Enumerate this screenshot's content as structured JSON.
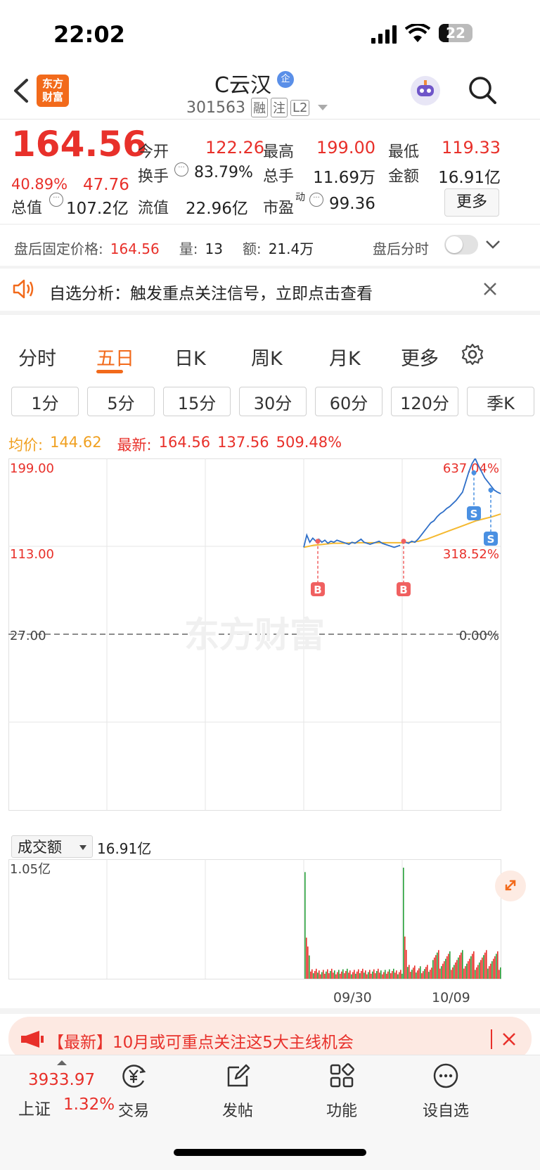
{
  "status_bar": {
    "time": "22:02",
    "battery": "22"
  },
  "header": {
    "logo_line1": "东方",
    "logo_line2": "财富",
    "stock_name": "C云汉",
    "badge": "企",
    "code": "301563",
    "tag1": "融",
    "tag2": "注",
    "tag3": "L2"
  },
  "quote": {
    "price": "164.56",
    "change_pct": "40.89%",
    "change": "47.76",
    "open_label": "今开",
    "open": "122.26",
    "high_label": "最高",
    "high": "199.00",
    "low_label": "最低",
    "low": "119.33",
    "turnover_label": "换手",
    "turnover": "83.79%",
    "volume_label": "总手",
    "volume": "11.69万",
    "amount_label": "金额",
    "amount": "16.91亿",
    "mktcap_label": "总值",
    "mktcap": "107.2亿",
    "float_label": "流值",
    "float_cap": "22.96亿",
    "pe_label": "市盈",
    "pe_sup": "动",
    "pe": "99.36",
    "more_button": "更多"
  },
  "after_hours": {
    "price_label": "盘后固定价格:",
    "price": "164.56",
    "vol_label": "量:",
    "vol": "13",
    "amt_label": "额:",
    "amt": "21.4万",
    "toggle_label": "盘后分时",
    "toggle_on": false
  },
  "notice": {
    "text": "自选分析：触发重点关注信号，立即点击查看"
  },
  "tabs": [
    {
      "label": "分时"
    },
    {
      "label": "五日"
    },
    {
      "label": "日K"
    },
    {
      "label": "周K"
    },
    {
      "label": "月K"
    },
    {
      "label": "更多"
    }
  ],
  "active_tab": "五日",
  "periods": [
    "1分",
    "5分",
    "15分",
    "30分",
    "60分",
    "120分",
    "季K"
  ],
  "chart_header": {
    "avg_label": "均价:",
    "avg": "144.62",
    "latest_label": "最新:",
    "latest": "164.56",
    "change": "137.56",
    "pct": "509.48%"
  },
  "watermark": "东方财富",
  "volume_header": {
    "selector": "成交额",
    "value": "16.91亿"
  },
  "chart_data": {
    "type": "line",
    "y_left_ticks": [
      "199.00",
      "113.00",
      "27.00"
    ],
    "y_right_ticks": [
      "637.04%",
      "318.52%",
      "0.00%"
    ],
    "ylim": [
      27.0,
      199.0
    ],
    "prev_close": 27.0,
    "x_labels": [
      "09/30",
      "10/09"
    ],
    "days": 5,
    "day_price_series": [
      {
        "day": 4,
        "values": [
          112,
          124,
          117,
          121,
          118,
          120,
          117,
          119,
          116,
          118,
          117,
          119,
          118,
          117,
          116,
          115,
          117,
          116,
          118,
          120,
          117,
          116,
          115,
          116,
          117,
          118,
          116,
          115,
          114,
          113,
          112,
          113,
          114
        ]
      },
      {
        "day": 5,
        "values": [
          116,
          117,
          116,
          118,
          117,
          120,
          124,
          128,
          132,
          136,
          138,
          142,
          145,
          147,
          150,
          152,
          155,
          158,
          162,
          166,
          176,
          186,
          194,
          199,
          192,
          186,
          180,
          176,
          172,
          168,
          166,
          164.56
        ]
      }
    ],
    "avg_series": [
      {
        "day": 4,
        "values": [
          112,
          114,
          115,
          116,
          116,
          116.5,
          116.5,
          116.5,
          116.5,
          116.5,
          116.5
        ]
      },
      {
        "day": 5,
        "values": [
          116.5,
          117,
          118,
          120,
          123,
          126,
          129,
          132,
          135,
          138,
          140,
          142,
          144.62
        ]
      }
    ],
    "markers": [
      {
        "type": "B",
        "day": 4,
        "price": 118
      },
      {
        "type": "B",
        "day": 5,
        "price": 118
      },
      {
        "type": "S",
        "day": 5,
        "price": 185
      },
      {
        "type": "S",
        "day": 5,
        "price": 168
      }
    ],
    "volume_max_label": "1.05亿",
    "volume_max": 1.05
  },
  "banner": {
    "text": "【最新】10月或可重点关注这5大主线机会"
  },
  "bottom_nav": {
    "index_value": "3933.97",
    "index_name": "上证",
    "index_pct": "1.32%",
    "items": [
      {
        "label": "交易",
        "icon": "yen-circle-icon"
      },
      {
        "label": "发帖",
        "icon": "edit-icon"
      },
      {
        "label": "功能",
        "icon": "grid-icon"
      },
      {
        "label": "设自选",
        "icon": "more-dots-icon"
      }
    ]
  }
}
